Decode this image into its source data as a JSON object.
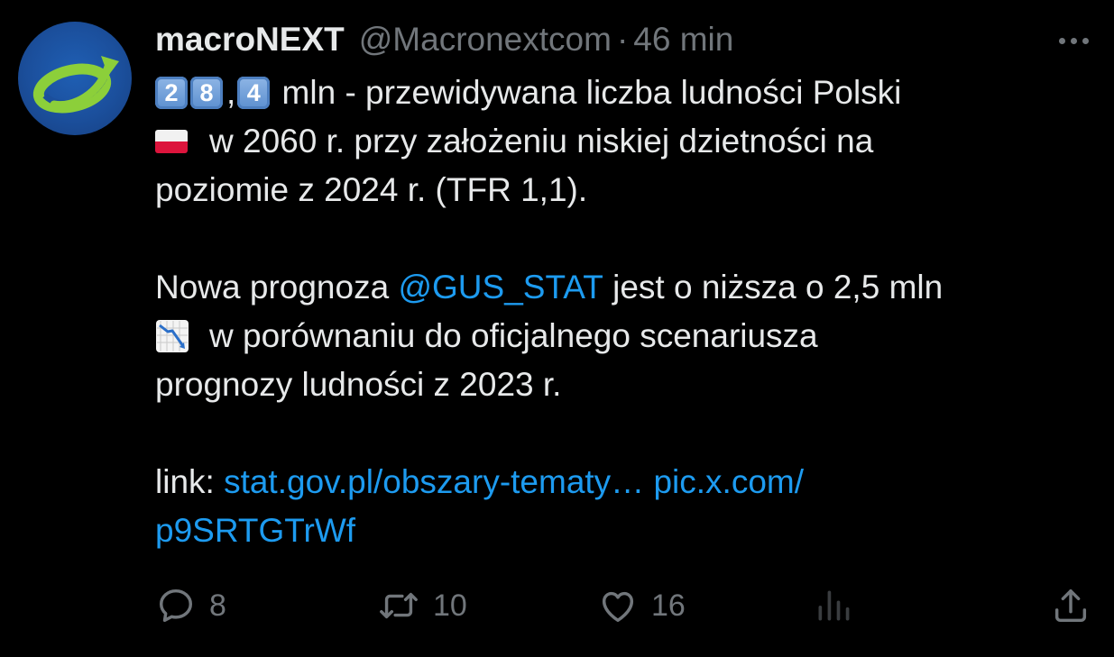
{
  "tweet": {
    "author_name": "macroNEXT",
    "author_handle": "@Macronextcom",
    "separator": "·",
    "time": "46 min",
    "keycaps": [
      "2",
      "8",
      "4"
    ],
    "keycap_comma": ",",
    "line1_rest": " mln - przewidywana liczba ludności Polski",
    "line2_rest": "w 2060 r. przy założeniu niskiej dzietności na",
    "line3": "poziomie z 2024 r. (TFR 1,1).",
    "line4_pre": "Nowa prognoza ",
    "line4_mention": "@GUS_STAT",
    "line4_post": " jest o niższa o 2,5 mln",
    "line5_rest": "w porównaniu do oficjalnego scenariusza",
    "line6": "prognozy ludności z 2023 r.",
    "line7_pre": "link: ",
    "line7_link1": "stat.gov.pl/obszary-tematy…",
    "line7_space": " ",
    "line7_link2": "pic.x.com/",
    "line8_link2_cont": "p9SRTGTrWf"
  },
  "actions": {
    "replies": "8",
    "reposts": "10",
    "likes": "16"
  },
  "icons": {
    "avatar": "macronext-logo",
    "flag": "poland-flag-emoji",
    "chart": "chart-decreasing-emoji",
    "reply": "reply-icon",
    "repost": "repost-icon",
    "like": "heart-icon",
    "views": "views-icon",
    "share": "share-icon",
    "more": "more-icon"
  },
  "colors": {
    "background": "#000000",
    "text": "#e7e9ea",
    "secondary": "#71767b",
    "link": "#1d9bf0"
  }
}
